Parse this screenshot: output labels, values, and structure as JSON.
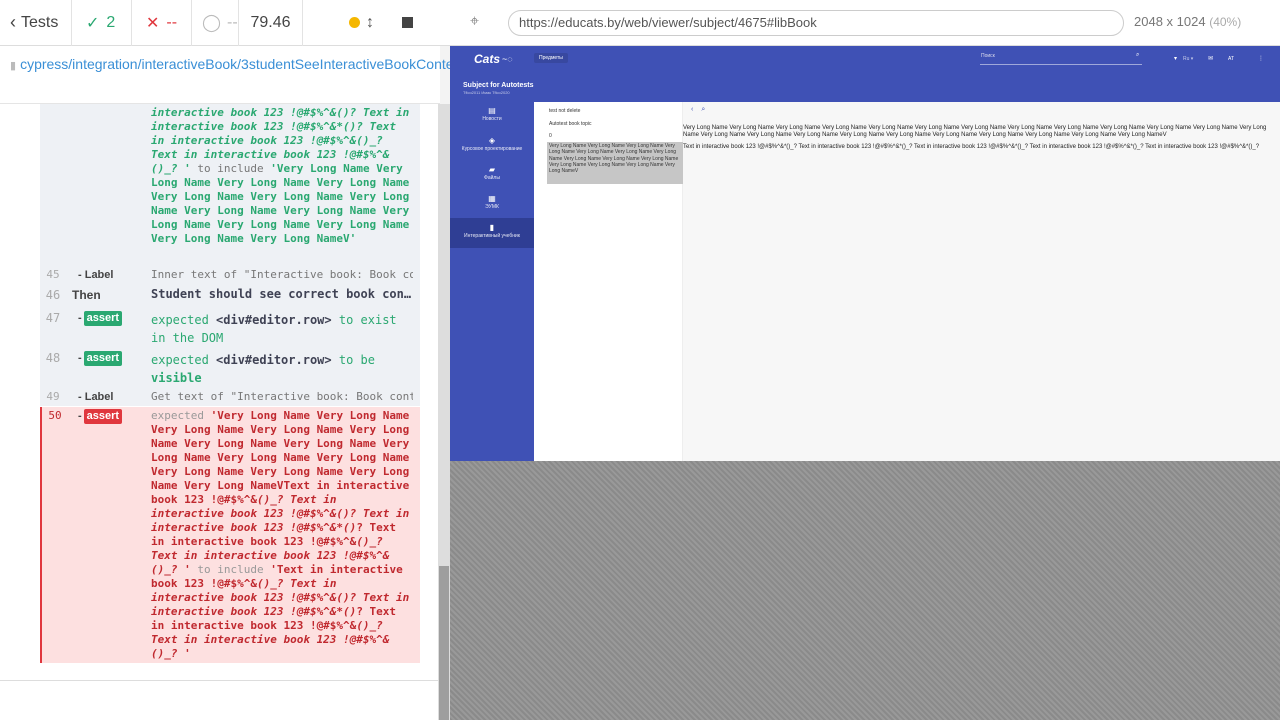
{
  "reporter": {
    "tests_label": "Tests",
    "passed_count": "2",
    "failed_count": "--",
    "pending_count": "--",
    "duration": "79.46",
    "spec_path": "cypress/integration/interactiveBook/3studentSeeInteractiveBookContent.feature",
    "commands": [
      {
        "num": "",
        "name": "",
        "parts": [
          {
            "t": "interactive book 123 !@#$%^&()? Text in interactive book 123 !@#$%^&*()? Text in interactive book 123 !@#$%^&()_? Text in interactive book 123 !@#$%^&()_? '",
            "c": "gi"
          },
          {
            "t": " to include ",
            "c": ""
          },
          {
            "t": "'Very Long Name Very Long Name Very Long Name Very Long Name Very Long Name Very Long Name Very Long Name Very Long Name Very Long Name Very Long Name Very Long Name Very Long Name Very Long Name Very Long NameV'",
            "c": "g"
          }
        ]
      },
      {
        "num": "45",
        "name": "- Label",
        "parts": [
          {
            "t": "Inner text of \"Interactive book: Book con…",
            "c": ""
          }
        ]
      },
      {
        "num": "46",
        "name": "Then",
        "parts": [
          {
            "t": "Student should see correct book con…",
            "c": "sel"
          }
        ]
      },
      {
        "num": "47",
        "name": "-",
        "tag": "assert",
        "parts": [
          {
            "t": "expected ",
            "c": "g2"
          },
          {
            "t": "<div#editor.row>",
            "c": "sel"
          },
          {
            "t": " to exist in the DOM",
            "c": "g2"
          }
        ]
      },
      {
        "num": "48",
        "name": "-",
        "tag": "assert",
        "parts": [
          {
            "t": "expected ",
            "c": "g2"
          },
          {
            "t": "<div#editor.row>",
            "c": "sel"
          },
          {
            "t": " to be ",
            "c": "g2"
          },
          {
            "t": "visible",
            "c": "g"
          }
        ]
      },
      {
        "num": "49",
        "name": "- Label",
        "parts": [
          {
            "t": "Get text of \"Interactive book: Book conte…",
            "c": ""
          }
        ]
      },
      {
        "num": "50",
        "name": "-",
        "tag": "assert",
        "failed": true,
        "parts": [
          {
            "t": "expected ",
            "c": ""
          },
          {
            "t": "'Very Long Name Very Long Name Very Long Name Very Long Name Very Long Name Very Long Name Very Long Name Very Long Name Very Long Name Very Long Name Very Long Name Very Long Name Very Long Name Very Long NameVText in interactive book 123 !@#$%^&",
            "c": "r"
          },
          {
            "t": "()_? Text in interactive book 123 !@#$%^&()? Text in interactive book 123 !@#$%^&*()",
            "c": "ri"
          },
          {
            "t": "? Text in interactive book 123 !@#$%^&",
            "c": "r"
          },
          {
            "t": "()_? Text in interactive book 123 !@#$%^&()_? '",
            "c": "ri"
          },
          {
            "t": " to include ",
            "c": ""
          },
          {
            "t": "'Text in interactive book 123 !@#$%^&",
            "c": "r"
          },
          {
            "t": "()_? Text in interactive book 123 !@#$%^&()? Text in interactive book 123 !@#$%^&*()",
            "c": "ri"
          },
          {
            "t": "? Text in interactive book 123 !@#$%^&",
            "c": "r"
          },
          {
            "t": "()_? Text in interactive book 123 !@#$%^&()_? '",
            "c": "ri"
          }
        ]
      }
    ]
  },
  "aut": {
    "url": "https://educats.by/web/viewer/subject/4675#libBook",
    "viewport": "2048 x 1024",
    "scale": "(40%)",
    "app": {
      "logo": "Cats",
      "subjects_button": "Предметы",
      "search_placeholder": "Поиск",
      "lang": "Ru",
      "user": "АТ",
      "subject_title": "Subject for Autotests",
      "subject_subtitle": "Tflco2011 Имак Tflco2020",
      "nav": [
        {
          "label": "Новости",
          "icon": "news-icon"
        },
        {
          "label": "Курсовое проектирование",
          "icon": "course-icon"
        },
        {
          "label": "Файлы",
          "icon": "files-icon"
        },
        {
          "label": "ЭУМК",
          "icon": "eumk-icon"
        },
        {
          "label": "Интерактивный учебник",
          "icon": "book-icon"
        }
      ],
      "topics": [
        "test not delete",
        "Autotest book topic",
        "0"
      ],
      "selected_topic": "Very Long Name Very Long Name Very Long Name Very Long Name Very Long Name Very Long Name Very Long Name Very Long Name Very Long Name Very Long Name Very Long Name Very Long Name Very Long Name Very Long NameV",
      "content_title": "Very Long Name Very Long Name Very Long Name Very Long Name Very Long Name Very Long Name Very Long Name Very Long Name Very Long Name Very Long Name Very Long Name Very Long Name Very Long Name Very Long Name Very Long Name Very Long Name Very Long Name Very Long Name Very Long Name Very Long Name Very Long Name Very Long Name Very Long NameV",
      "content_body": "Text in interactive book 123 !@#$%^&*()_? Text in interactive book 123 !@#$%^&*()_? Text in interactive book 123 !@#$%^&*()_? Text in interactive book 123 !@#$%^&*()_? Text in interactive book 123 !@#$%^&*()_?"
    }
  }
}
